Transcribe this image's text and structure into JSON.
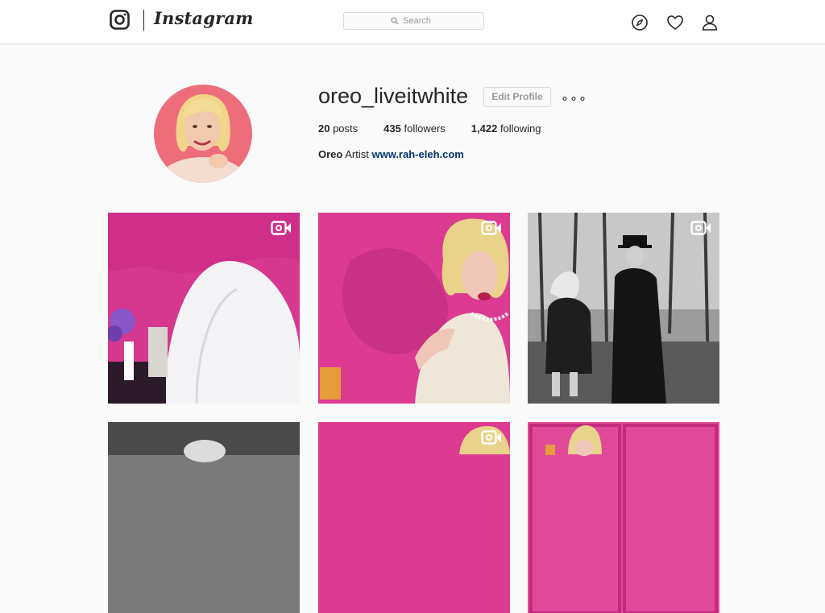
{
  "header": {
    "wordmark": "Instagram",
    "search_placeholder": "Search",
    "icons": [
      "instagram-glyph-icon",
      "search-icon",
      "compass-icon",
      "heart-icon",
      "user-icon"
    ]
  },
  "profile": {
    "username": "oreo_liveitwhite",
    "edit_label": "Edit Profile",
    "more_label": "∘∘∘",
    "stats": {
      "posts_count": "20",
      "posts_label": " posts",
      "followers_count": "435",
      "followers_label": " followers",
      "following_count": "1,422",
      "following_label": " following"
    },
    "bio": {
      "name": "Oreo",
      "text": " Artist ",
      "link": "www.rah-eleh.com"
    }
  },
  "grid": {
    "video_icon": "video-camera-icon",
    "colors": {
      "pink": "#d6378f",
      "accent_link": "#003569"
    }
  }
}
